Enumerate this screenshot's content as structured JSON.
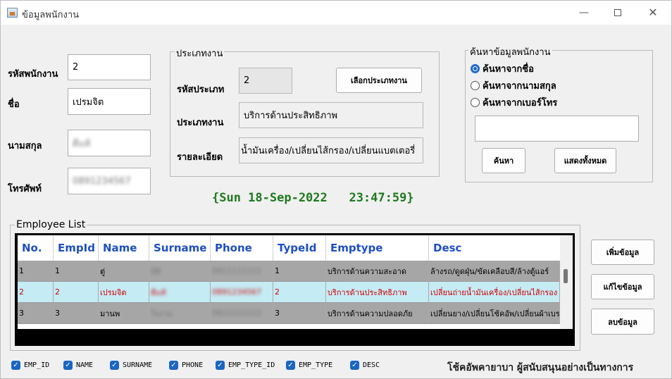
{
  "window": {
    "title": "ข้อมูลพนักงาน",
    "minimize": "—",
    "close": "✕"
  },
  "employee": {
    "id_label": "รหัสพนักงาน",
    "id_value": "2",
    "name_label": "ชื่อ",
    "name_value": "เปรมจิต",
    "surname_label": "นามสกุล",
    "surname_value": "ดีแท้",
    "phone_label": "โทรศัพท์",
    "phone_value": "0891234567"
  },
  "job_type": {
    "group_title": "ประเภทงาน",
    "type_id_label": "รหัสประเภท",
    "type_id_value": "2",
    "select_button": "เลือกประเภทงาน",
    "type_label": "ประเภทงาน",
    "type_value": "บริการด้านประสิทธิภาพ",
    "detail_label": "รายละเอียด",
    "detail_value": "น้ำมันเครื่อง/เปลี่ยนไส้กรอง/เปลี่ยนแบตเตอรี่"
  },
  "search": {
    "group_title": "ค้นหาข้อมูลพนักงาน",
    "options": [
      "ค้นหาจากชื่อ",
      "ค้นหาจากนามสกุล",
      "ค้นหาจากเบอร์โทร"
    ],
    "selected_index": 0,
    "query": "",
    "search_button": "ค้นหา",
    "show_all_button": "แสดงทั้งหมด"
  },
  "clock": "{Sun 18-Sep-2022   23:47:59}",
  "table": {
    "group_title": "Employee List",
    "columns": [
      "No.",
      "EmpId",
      "Name",
      "Surname",
      "Phone",
      "TypeId",
      "Emptype",
      "Desc"
    ],
    "rows": [
      [
        "1",
        "1",
        "ตู่",
        "มีดี",
        "0811111111",
        "1",
        "บริการด้านความสะอาด",
        "ล้างรถ/ดูดฝุ่น/ขัดเคลือบสี/ล้างตู้แอร์"
      ],
      [
        "2",
        "2",
        "เปรมจิต",
        "ดีแท้",
        "0891234567",
        "2",
        "บริการด้านประสิทธิภาพ",
        "เปลี่ยนถ่ายน้ำมันเครื่อง/เปลี่ยนไส้กรอง"
      ],
      [
        "3",
        "3",
        "มานพ",
        "ใจงาม",
        "0822222222",
        "3",
        "บริการด้านความปลอดภัย",
        "เปลี่ยนยาง/เปลี่ยนโช้คอัพ/เปลี่ยนผ้าเบรก"
      ]
    ],
    "selected_row": 1
  },
  "actions": {
    "add": "เพิ่มข้อมูล",
    "edit": "แก้ไขข้อมูล",
    "delete": "ลบข้อมูล"
  },
  "column_toggles": [
    "EMP_ID",
    "NAME",
    "SURNAME",
    "PHONE",
    "EMP_TYPE_ID",
    "EMP_TYPE",
    "DESC"
  ],
  "footer": "โช้คอัพคายาบา ผู้สนับสนุนอย่างเป็นทางการ",
  "colors": {
    "accent": "#1a66c2",
    "clock": "#1e7a1e",
    "header_text": "#1e4fc2",
    "selected_row_bg": "#c5ebf4",
    "selected_row_text": "#d00000"
  }
}
